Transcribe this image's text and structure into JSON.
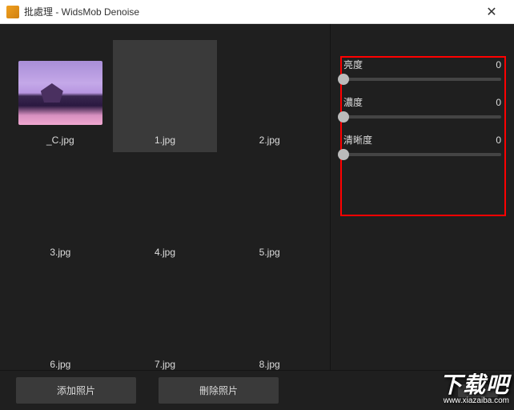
{
  "titlebar": {
    "title": "批處理 - WidsMob Denoise",
    "close": "✕"
  },
  "thumbnails": [
    {
      "label": "_C.jpg",
      "hasImage": true,
      "selected": false
    },
    {
      "label": "1.jpg",
      "hasImage": false,
      "selected": true
    },
    {
      "label": "2.jpg",
      "hasImage": false,
      "selected": false
    },
    {
      "label": "3.jpg",
      "hasImage": false,
      "selected": false
    },
    {
      "label": "4.jpg",
      "hasImage": false,
      "selected": false
    },
    {
      "label": "5.jpg",
      "hasImage": false,
      "selected": false
    },
    {
      "label": "6.jpg",
      "hasImage": false,
      "selected": false
    },
    {
      "label": "7.jpg",
      "hasImage": false,
      "selected": false
    },
    {
      "label": "8.jpg",
      "hasImage": false,
      "selected": false
    }
  ],
  "sliders": [
    {
      "label": "亮度",
      "value": "0"
    },
    {
      "label": "濃度",
      "value": "0"
    },
    {
      "label": "清晰度",
      "value": "0"
    }
  ],
  "buttons": {
    "add": "添加照片",
    "remove": "刪除照片"
  },
  "watermark": {
    "main": "下载吧",
    "sub": "www.xiazaiba.com"
  }
}
